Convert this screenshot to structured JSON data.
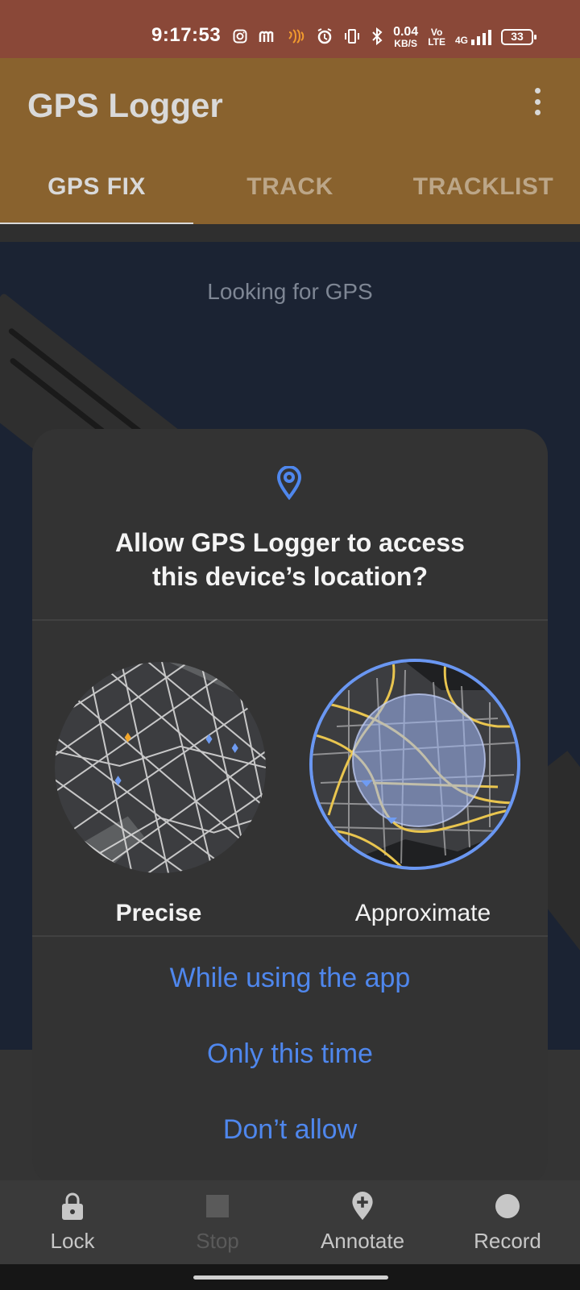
{
  "status_bar": {
    "time": "9:17:53",
    "icons": [
      "instagram-icon",
      "m-app-icon",
      "app-notification-icon",
      "alarm-icon",
      "vibrate-icon",
      "bluetooth-icon",
      "data-speed-icon",
      "volte-icon",
      "4g-signal-icon",
      "battery-icon"
    ],
    "speed_value": "0.04",
    "speed_unit": "KB/S",
    "volte_top": "Vo",
    "volte_bottom": "LTE",
    "network": "4G",
    "battery": "33"
  },
  "app": {
    "title": "GPS Logger",
    "menu_icon": "more-vertical-icon",
    "tabs": [
      {
        "label": "GPS FIX",
        "selected": true
      },
      {
        "label": "TRACK",
        "selected": false
      },
      {
        "label": "TRACKLIST",
        "selected": false
      }
    ]
  },
  "content": {
    "status_text": "Looking for GPS"
  },
  "dialog": {
    "icon": "location-pin-icon",
    "title_line1": "Allow GPS Logger to access",
    "title_line2": "this device’s location?",
    "options": [
      {
        "label": "Precise",
        "selected": true,
        "icon": "precise-map-icon"
      },
      {
        "label": "Approximate",
        "selected": false,
        "icon": "approximate-map-icon"
      }
    ],
    "actions": [
      {
        "label": "While using the app"
      },
      {
        "label": "Only this time"
      },
      {
        "label": "Don’t allow"
      }
    ],
    "accent_color": "#4f87ed"
  },
  "bottom_nav": [
    {
      "label": "Lock",
      "icon": "lock-icon",
      "enabled": true
    },
    {
      "label": "Stop",
      "icon": "stop-icon",
      "enabled": false
    },
    {
      "label": "Annotate",
      "icon": "add-location-icon",
      "enabled": true
    },
    {
      "label": "Record",
      "icon": "record-icon",
      "enabled": true
    }
  ],
  "colors": {
    "status_bar": "#8a4838",
    "app_bar": "#89622e",
    "map_background": "#1b2333",
    "dialog": "#333333",
    "nav_background": "#3a3a3a"
  }
}
